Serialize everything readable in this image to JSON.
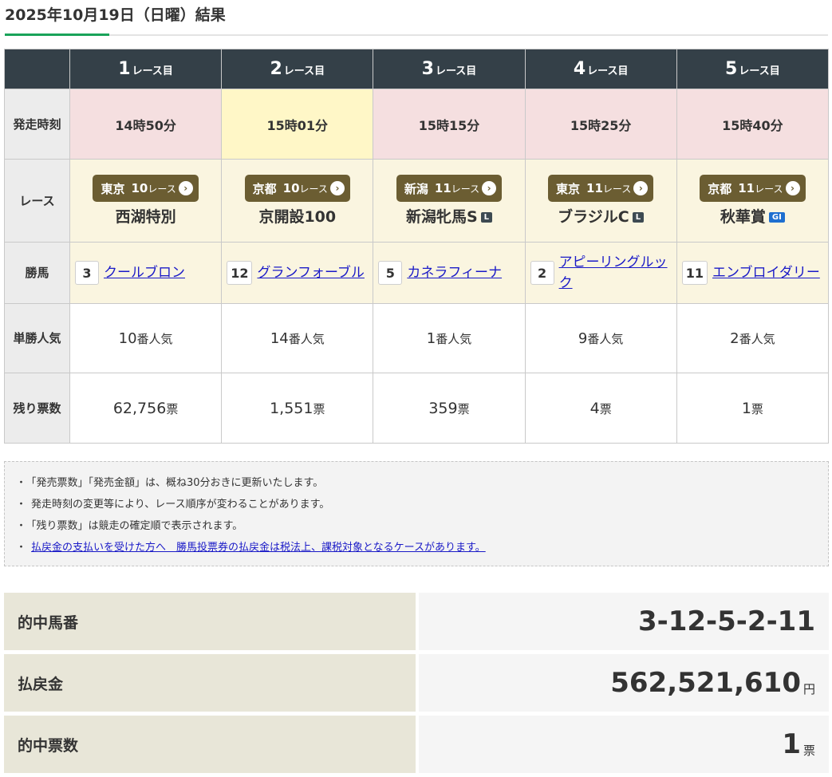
{
  "page_title": "2025年10月19日（日曜）結果",
  "header": {
    "corner": "",
    "races": [
      {
        "num": "1",
        "suffix": "レース目"
      },
      {
        "num": "2",
        "suffix": "レース目"
      },
      {
        "num": "3",
        "suffix": "レース目"
      },
      {
        "num": "4",
        "suffix": "レース目"
      },
      {
        "num": "5",
        "suffix": "レース目"
      }
    ]
  },
  "row_labels": {
    "start_time": "発走時刻",
    "race": "レース",
    "winner": "勝馬",
    "popularity": "単勝人気",
    "remaining": "残り票数"
  },
  "start_times": [
    "14時50分",
    "15時01分",
    "15時15分",
    "15時25分",
    "15時40分"
  ],
  "races": [
    {
      "venue": "東京",
      "no": "10",
      "suffix": "レース",
      "name": "西湖特別",
      "grade": ""
    },
    {
      "venue": "京都",
      "no": "10",
      "suffix": "レース",
      "name": "京開設100",
      "grade": ""
    },
    {
      "venue": "新潟",
      "no": "11",
      "suffix": "レース",
      "name": "新潟牝馬S",
      "grade": "L"
    },
    {
      "venue": "東京",
      "no": "11",
      "suffix": "レース",
      "name": "ブラジルC",
      "grade": "L"
    },
    {
      "venue": "京都",
      "no": "11",
      "suffix": "レース",
      "name": "秋華賞",
      "grade": "GI"
    }
  ],
  "winners": [
    {
      "num": "3",
      "name": "クールブロン"
    },
    {
      "num": "12",
      "name": "グランフォーブル"
    },
    {
      "num": "5",
      "name": "カネラフィーナ"
    },
    {
      "num": "2",
      "name": "アピーリングルック"
    },
    {
      "num": "11",
      "name": "エンブロイダリー"
    }
  ],
  "popularity": [
    {
      "value": "10",
      "unit": "番人気"
    },
    {
      "value": "14",
      "unit": "番人気"
    },
    {
      "value": "1",
      "unit": "番人気"
    },
    {
      "value": "9",
      "unit": "番人気"
    },
    {
      "value": "2",
      "unit": "番人気"
    }
  ],
  "remaining": [
    {
      "value": "62,756",
      "unit": "票"
    },
    {
      "value": "1,551",
      "unit": "票"
    },
    {
      "value": "359",
      "unit": "票"
    },
    {
      "value": "4",
      "unit": "票"
    },
    {
      "value": "1",
      "unit": "票"
    }
  ],
  "notes": {
    "bullet": "・",
    "items": [
      "「発売票数」「発売金額」は、概ね30分おきに更新いたします。",
      "発走時刻の変更等により、レース順序が変わることがあります。",
      "「残り票数」は競走の確定順で表示されます。"
    ],
    "link": "払戻金の支払いを受けた方へ　勝馬投票券の払戻金は税法上、課税対象となるケースがあります。"
  },
  "summary": {
    "hit_numbers": {
      "label": "的中馬番",
      "value": "3-12-5-2-11"
    },
    "payout": {
      "label": "払戻金",
      "value": "562,521,610",
      "unit": "円"
    },
    "hit_tickets": {
      "label": "的中票数",
      "value": "1",
      "unit": "票"
    }
  },
  "colors": {
    "accent_green": "#19a35a",
    "header_dark": "#344048",
    "venue_badge": "#6b5d32",
    "highlight_pink": "#f5dfe0",
    "highlight_yellow": "#fff7c7",
    "grade_gi_blue": "#1e6fd0",
    "link_blue": "#1a1ac7"
  },
  "icons": {
    "venue_arrow": "chevron-circle-right-icon"
  }
}
